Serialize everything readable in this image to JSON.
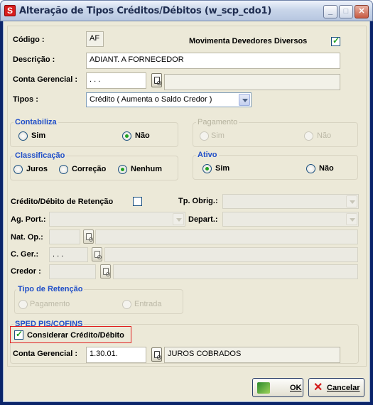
{
  "window": {
    "title": "Alteração de Tipos Créditos/Débitos (w_scp_cdo1)",
    "app_icon_letter": "S",
    "minimize_glyph": "_",
    "maximize_glyph": "□",
    "close_glyph": "✕"
  },
  "form": {
    "codigo_label": "Código :",
    "codigo_value": "AF",
    "movimenta_label": "Movimenta Devedores Diversos",
    "movimenta_checked": true,
    "descricao_label": "Descrição :",
    "descricao_value": "ADIANT. A FORNECEDOR",
    "conta_gerencial_label": "Conta Gerencial :",
    "conta_gerencial_value": ". . .",
    "conta_gerencial_desc": "",
    "tipos_label": "Tipos :",
    "tipos_value": "Crédito ( Aumenta o Saldo Credor )"
  },
  "contabiliza": {
    "label": "Contabiliza",
    "options": [
      "Sim",
      "Não"
    ],
    "selected": "Não"
  },
  "pagamento": {
    "label": "Pagamento",
    "options": [
      "Sim",
      "Não"
    ]
  },
  "classificacao": {
    "label": "Classificação",
    "options": [
      "Juros",
      "Correção",
      "Nenhum"
    ],
    "selected": "Nenhum"
  },
  "ativo": {
    "label": "Ativo",
    "options": [
      "Sim",
      "Não"
    ],
    "selected": "Sim"
  },
  "retencao": {
    "credito_debito_label": "Crédito/Débito de Retenção",
    "tp_obrig_label": "Tp. Obrig.:",
    "ag_port_label": "Ag. Port.:",
    "depart_label": "Depart.:",
    "nat_op_label": "Nat. Op.:",
    "c_ger_label": "C. Ger.:",
    "c_ger_value": ". . .",
    "credor_label": "Credor :",
    "tipo_label": "Tipo de Retenção",
    "tipo_options": [
      "Pagamento",
      "Entrada"
    ]
  },
  "sped": {
    "label": "SPED PIS/COFINS",
    "considerar_label": "Considerar Crédito/Débito",
    "considerar_checked": true,
    "conta_label": "Conta Gerencial :",
    "conta_value": "1.30.01.",
    "conta_desc": "JUROS COBRADOS"
  },
  "buttons": {
    "ok": "OK",
    "cancel": "Cancelar"
  },
  "colors": {
    "group_label": "#1f4ec8",
    "radio_selected": "#21a121",
    "highlight": "#e02020"
  }
}
